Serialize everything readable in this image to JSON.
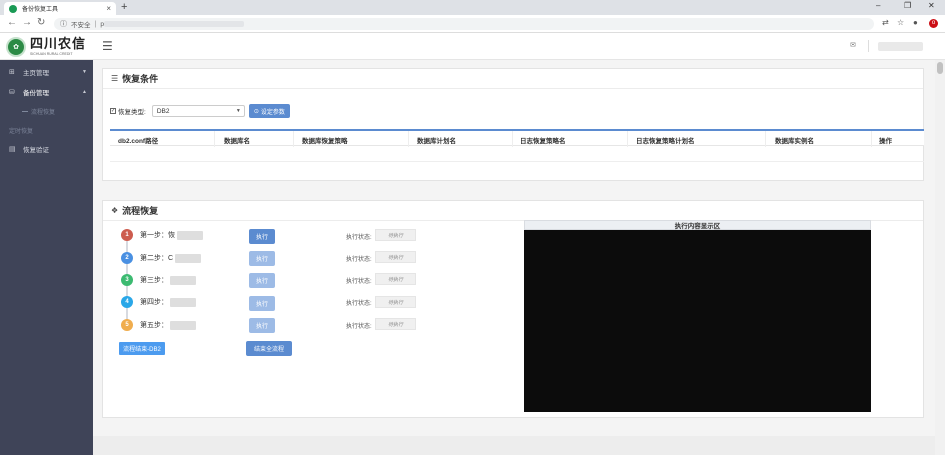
{
  "browser": {
    "tab_title": "备份恢复工具",
    "tab_close": "×",
    "new_tab": "+",
    "insecure_label": "不安全",
    "url_prefix": "p",
    "controls": [
      "–",
      "❐",
      "✕"
    ]
  },
  "header": {
    "logo_cn": "四川农信",
    "logo_en": "SICHUAN RURAL CREDIT",
    "menu_icon": "☰"
  },
  "sidebar": {
    "items": [
      {
        "label": "主页管理",
        "icon": "grid-icon"
      },
      {
        "label": "备份管理",
        "icon": "database-icon"
      }
    ],
    "sub_item": "流程恢复",
    "loose_item": "定时恢复",
    "verify": {
      "label": "恢复验证",
      "icon": "document-icon"
    }
  },
  "conditions": {
    "title": "恢复条件",
    "type_label": "恢复类型:",
    "type_value": "DB2",
    "set_params_label": "设定参数",
    "columns": [
      "db2.conf路径",
      "数据库名",
      "数据库恢复策略",
      "数据库计划名",
      "日志恢复策略名",
      "日志恢复策略计划名",
      "数据库实例名",
      "操作"
    ]
  },
  "flow": {
    "title": "流程恢复",
    "steps": [
      {
        "num": "1",
        "label": "第一步：恢",
        "color": "#cd5c4e"
      },
      {
        "num": "2",
        "label": "第二步：C",
        "color": "#4a90e2"
      },
      {
        "num": "3",
        "label": "第三步：",
        "color": "#3cba71"
      },
      {
        "num": "4",
        "label": "第四步：",
        "color": "#2aa7e8"
      },
      {
        "num": "5",
        "label": "第五步：",
        "color": "#f0ad4e"
      }
    ],
    "exec_label": "执行",
    "status_label": "执行状态:",
    "status_value": "待执行",
    "flow_end_label": "流程结束-DB2",
    "end_all_label": "结束全流程",
    "display_title": "执行内容显示区"
  }
}
